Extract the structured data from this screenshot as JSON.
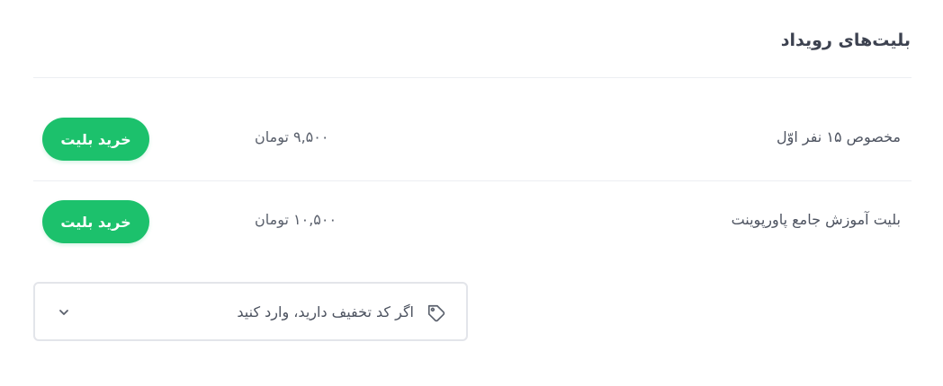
{
  "section": {
    "title": "بلیت‌های رویداد"
  },
  "tickets": [
    {
      "name": "مخصوص ۱۵ نفر اوّل",
      "price": "۹,۵۰۰ تومان",
      "button": "خرید بلیت"
    },
    {
      "name": "بلیت آموزش جامع پاورپوینت",
      "price": "۱۰,۵۰۰ تومان",
      "button": "خرید بلیت"
    }
  ],
  "coupon": {
    "text": "اگر کد تخفیف دارید، وارد کنید",
    "icon": "tag-icon",
    "toggle_icon": "chevron-down-icon"
  },
  "colors": {
    "accent": "#1cc16c",
    "text": "#4d5360",
    "border": "#e3e5ea"
  }
}
